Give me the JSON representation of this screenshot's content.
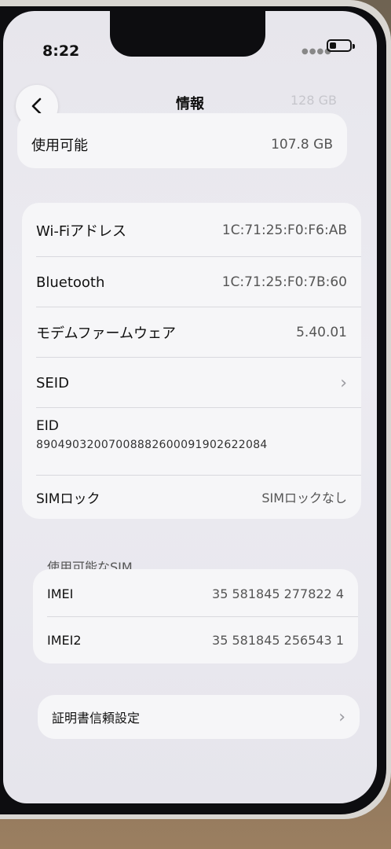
{
  "status": {
    "time": "8:22"
  },
  "nav": {
    "title": "情報",
    "ghost_value": "128 GB"
  },
  "storage": {
    "label": "使用可能",
    "value": "107.8 GB"
  },
  "network": {
    "wifi_label": "Wi-Fiアドレス",
    "wifi_value": "1C:71:25:F0:F6:AB",
    "bt_label": "Bluetooth",
    "bt_value": "1C:71:25:F0:7B:60",
    "modem_label": "モデムファームウェア",
    "modem_value": "5.40.01",
    "seid_label": "SEID",
    "eid_label": "EID",
    "eid_value": "89049032007008882600091902622084",
    "simlock_label": "SIMロック",
    "simlock_value": "SIMロックなし"
  },
  "sim": {
    "header": "使用可能なSIM",
    "imei_label": "IMEI",
    "imei_value": "35 581845 277822 4",
    "imei2_label": "IMEI2",
    "imei2_value": "35 581845 256543 1"
  },
  "certs": {
    "label": "証明書信頼設定"
  },
  "icons": {
    "back": "chevron-left-icon",
    "disclosure": "chevron-right-icon"
  }
}
